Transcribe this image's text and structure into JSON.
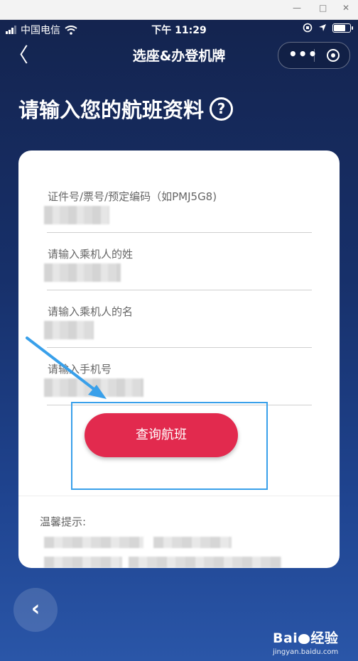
{
  "window": {
    "minimize": "—",
    "maximize": "□",
    "close": "✕"
  },
  "status_bar": {
    "carrier": "中国电信",
    "time": "下午 11:29"
  },
  "nav": {
    "back": "〈",
    "title": "选座&办登机牌",
    "more": "•••"
  },
  "page": {
    "title": "请输入您的航班资料",
    "help": "?"
  },
  "form": {
    "fields": [
      {
        "label": "证件号/票号/预定编码（如PMJ5G8)"
      },
      {
        "label": "请输入乘机人的姓"
      },
      {
        "label": "请输入乘机人的名"
      },
      {
        "label": "请输入手机号"
      }
    ],
    "submit_label": "查询航班"
  },
  "tips": {
    "label": "温馨提示:"
  },
  "float_back": "‹",
  "watermark": {
    "brand_left": "Bai",
    "brand_right": "经验",
    "url": "jingyan.baidu.com"
  },
  "colors": {
    "primary_button": "#e22a4e",
    "annotation": "#39a0ea",
    "background_top": "#14244f",
    "background_bottom": "#2a56a8"
  },
  "icons": [
    "signal-icon",
    "wifi-icon",
    "location-icon",
    "battery-icon",
    "back-chevron-icon",
    "more-dots-icon",
    "target-icon",
    "help-icon"
  ]
}
